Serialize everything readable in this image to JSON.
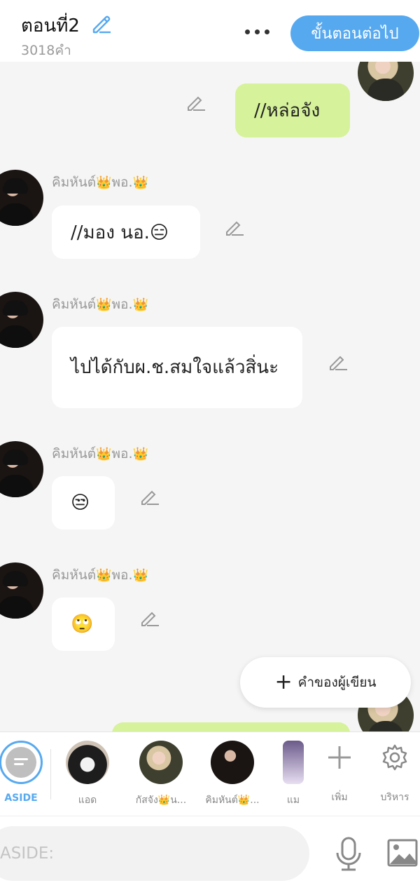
{
  "header": {
    "title": "ตอนที่2",
    "word_count": "3018คำ",
    "next_label": "ขั้นตอนต่อไป"
  },
  "messages": [
    {
      "side": "right",
      "text": "//หล่อจัง"
    },
    {
      "side": "left",
      "sender": "คิมหันต์",
      "sender_suffix": "พอ.",
      "text": "//มอง นอ.😑"
    },
    {
      "side": "left",
      "sender": "คิมหันต์",
      "sender_suffix": "พอ.",
      "text": "ไปได้กับผ.ช.สมใจแล้วสิ่นะ"
    },
    {
      "side": "left",
      "sender": "คิมหันต์",
      "sender_suffix": "พอ.",
      "text": "😒"
    },
    {
      "side": "left",
      "sender": "คิมหันต์",
      "sender_suffix": "พอ.",
      "text": "🙄"
    }
  ],
  "author_note_label": "คำของผู้เขียน",
  "characters": [
    {
      "label": "ASIDE",
      "type": "aside"
    },
    {
      "label": "แอด",
      "type": "cat"
    },
    {
      "label": "กัสจัง👑น...",
      "type": "woman"
    },
    {
      "label": "คิมหันต์👑...",
      "type": "man"
    },
    {
      "label": "แม",
      "type": "partial"
    }
  ],
  "char_actions": [
    {
      "label": "เพิ่ม",
      "icon": "plus-icon"
    },
    {
      "label": "บริหาร",
      "icon": "gear-icon"
    }
  ],
  "input": {
    "placeholder": "ASIDE:"
  },
  "colors": {
    "accent": "#57a9ef",
    "my_bubble": "#d6f29a",
    "background": "#f5f5f5"
  }
}
